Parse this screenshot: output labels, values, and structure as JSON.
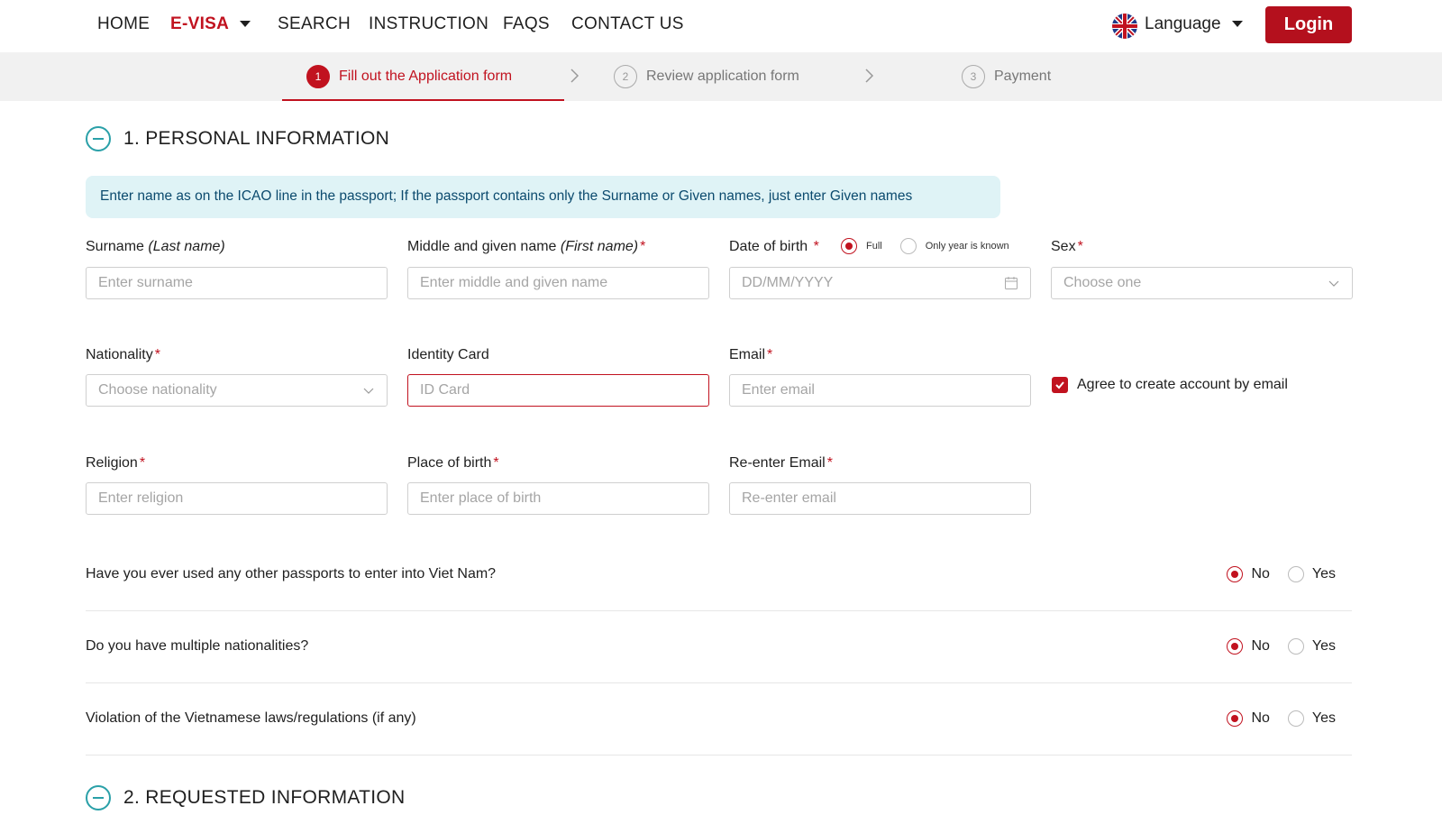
{
  "nav": {
    "items": [
      "HOME",
      "E-VISA",
      "SEARCH",
      "INSTRUCTION",
      "FAQS",
      "CONTACT US"
    ],
    "language_label": "Language",
    "login_label": "Login"
  },
  "steps": [
    {
      "num": "1",
      "label": "Fill out the Application form"
    },
    {
      "num": "2",
      "label": "Review application form"
    },
    {
      "num": "3",
      "label": "Payment"
    }
  ],
  "section1": {
    "title": "1. PERSONAL INFORMATION",
    "notice": "Enter name as on the ICAO line in the passport; If the passport contains only the Surname or Given names, just enter Given names"
  },
  "fields": {
    "surname": {
      "label": "Surname",
      "hint": "(Last name)",
      "placeholder": "Enter surname"
    },
    "given": {
      "label": "Middle and given name",
      "hint": "(First name)",
      "placeholder": "Enter middle and given name"
    },
    "dob": {
      "label": "Date of birth",
      "placeholder": "DD/MM/YYYY",
      "opt_full": "Full",
      "opt_year": "Only year is known"
    },
    "sex": {
      "label": "Sex",
      "placeholder": "Choose one"
    },
    "nationality": {
      "label": "Nationality",
      "placeholder": "Choose nationality"
    },
    "identity": {
      "label": "Identity Card",
      "placeholder": "ID Card"
    },
    "email": {
      "label": "Email",
      "placeholder": "Enter email"
    },
    "agree": "Agree to create account by email",
    "religion": {
      "label": "Religion",
      "placeholder": "Enter religion"
    },
    "pob": {
      "label": "Place of birth",
      "placeholder": "Enter place of birth"
    },
    "reemail": {
      "label": "Re-enter Email",
      "placeholder": "Re-enter email"
    }
  },
  "questions": [
    {
      "text": "Have you ever used any other passports to enter into Viet Nam?",
      "no": "No",
      "yes": "Yes"
    },
    {
      "text": "Do you have multiple nationalities?",
      "no": "No",
      "yes": "Yes"
    },
    {
      "text": "Violation of the Vietnamese laws/regulations (if any)",
      "no": "No",
      "yes": "Yes"
    }
  ],
  "section2": {
    "title": "2. REQUESTED INFORMATION"
  },
  "colors": {
    "accent": "#c1121f",
    "teal": "#2aa0a8",
    "notice_bg": "#dff3f6"
  }
}
